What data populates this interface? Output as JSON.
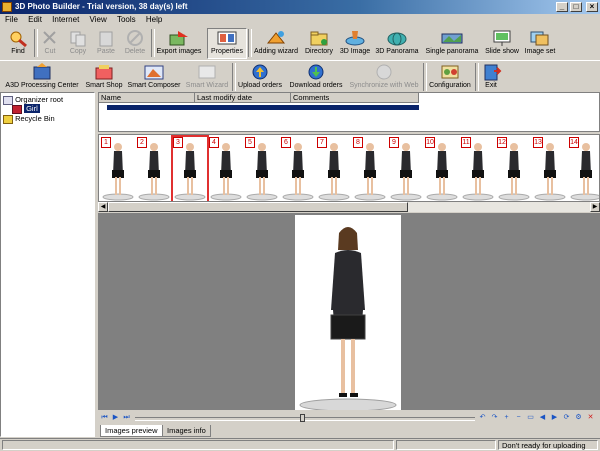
{
  "window": {
    "title": "3D Photo Builder - Trial version, 38 day(s) left"
  },
  "menu": [
    "File",
    "Edit",
    "Internet",
    "View",
    "Tools",
    "Help"
  ],
  "toolbar1": [
    {
      "label": "Find",
      "enabled": true,
      "icon": "find-icon"
    },
    {
      "label": "Cut",
      "enabled": false,
      "icon": "cut-icon"
    },
    {
      "label": "Copy",
      "enabled": false,
      "icon": "copy-icon"
    },
    {
      "label": "Paste",
      "enabled": false,
      "icon": "paste-icon"
    },
    {
      "label": "Delete",
      "enabled": false,
      "icon": "delete-icon"
    },
    {
      "label": "Export images",
      "enabled": true,
      "icon": "export-images-icon"
    },
    {
      "label": "Properties",
      "enabled": true,
      "icon": "properties-icon"
    },
    {
      "label": "Adding wizard",
      "enabled": true,
      "icon": "adding-wizard-icon"
    },
    {
      "label": "Directory",
      "enabled": true,
      "icon": "directory-icon"
    },
    {
      "label": "3D Image",
      "enabled": true,
      "icon": "3d-image-icon"
    },
    {
      "label": "3D Panorama",
      "enabled": true,
      "icon": "3d-panorama-icon"
    },
    {
      "label": "Single panorama",
      "enabled": true,
      "icon": "single-panorama-icon"
    },
    {
      "label": "Slide show",
      "enabled": true,
      "icon": "slide-show-icon"
    },
    {
      "label": "Image set",
      "enabled": true,
      "icon": "image-set-icon"
    }
  ],
  "toolbar2": [
    {
      "label": "A3D Processing Center",
      "enabled": true,
      "icon": "processing-center-icon"
    },
    {
      "label": "Smart Shop",
      "enabled": true,
      "icon": "smart-shop-icon"
    },
    {
      "label": "Smart Composer",
      "enabled": true,
      "icon": "smart-composer-icon"
    },
    {
      "label": "Smart Wizard",
      "enabled": false,
      "icon": "smart-wizard-icon"
    },
    {
      "label": "Upload orders",
      "enabled": true,
      "icon": "upload-orders-icon"
    },
    {
      "label": "Download orders",
      "enabled": true,
      "icon": "download-orders-icon"
    },
    {
      "label": "Synchronize with Web",
      "enabled": false,
      "icon": "synchronize-icon"
    },
    {
      "label": "Configuration",
      "enabled": true,
      "icon": "configuration-icon"
    },
    {
      "label": "Exit",
      "enabled": true,
      "icon": "exit-icon"
    }
  ],
  "tree": {
    "root": "Organizer root",
    "child": "Girl",
    "recycle": "Recycle Bin"
  },
  "table": {
    "columns": [
      "Name",
      "Last modify date",
      "Comments"
    ]
  },
  "thumbnails": [
    "1",
    "2",
    "3",
    "4",
    "5",
    "6",
    "7",
    "8",
    "9",
    "10",
    "11",
    "12",
    "13",
    "14"
  ],
  "selected_thumbnail": "3",
  "tabs": [
    "Images preview",
    "Images info"
  ],
  "active_tab": "Images preview",
  "status": {
    "right": "Don't ready for uploading"
  },
  "colors": {
    "title_start": "#0a246a",
    "title_end": "#a6caf0",
    "selection": "#e03030",
    "preview_bg": "#808080"
  }
}
